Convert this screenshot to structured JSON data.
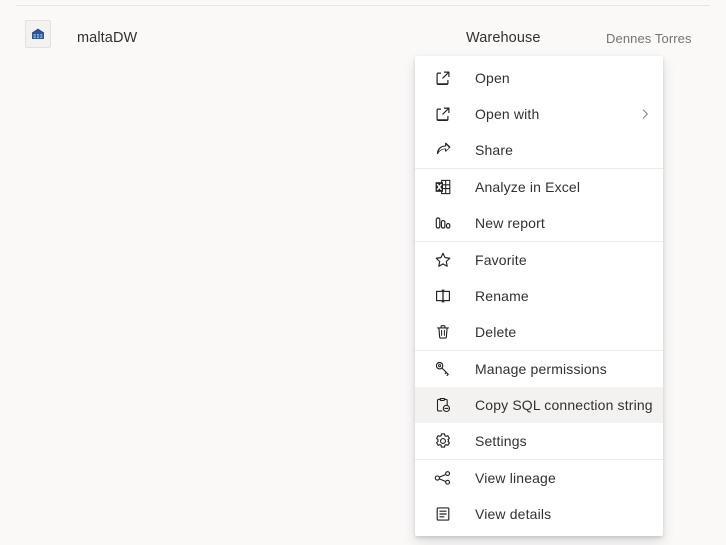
{
  "item": {
    "icon": "warehouse-icon",
    "name": "maltaDW",
    "type": "Warehouse",
    "owner": "Dennes Torres"
  },
  "context_menu": {
    "selected_item": "Copy SQL connection string",
    "highlight_color": "#f3f2f1",
    "groups": [
      {
        "items": [
          {
            "label": "Open",
            "icon": "open-external-icon",
            "submenu": false
          },
          {
            "label": "Open with",
            "icon": "open-external-icon",
            "submenu": true
          },
          {
            "label": "Share",
            "icon": "share-icon",
            "submenu": false
          }
        ]
      },
      {
        "items": [
          {
            "label": "Analyze in Excel",
            "icon": "excel-icon",
            "submenu": false
          },
          {
            "label": "New report",
            "icon": "bar-chart-icon",
            "submenu": false
          }
        ]
      },
      {
        "items": [
          {
            "label": "Favorite",
            "icon": "star-icon",
            "submenu": false
          },
          {
            "label": "Rename",
            "icon": "rename-icon",
            "submenu": false
          },
          {
            "label": "Delete",
            "icon": "trash-icon",
            "submenu": false
          }
        ]
      },
      {
        "items": [
          {
            "label": "Manage permissions",
            "icon": "key-icon",
            "submenu": false
          },
          {
            "label": "Copy SQL connection string",
            "icon": "copy-link-icon",
            "submenu": false
          },
          {
            "label": "Settings",
            "icon": "gear-icon",
            "submenu": false
          }
        ]
      },
      {
        "items": [
          {
            "label": "View lineage",
            "icon": "lineage-icon",
            "submenu": false
          },
          {
            "label": "View details",
            "icon": "details-icon",
            "submenu": false
          }
        ]
      }
    ]
  }
}
